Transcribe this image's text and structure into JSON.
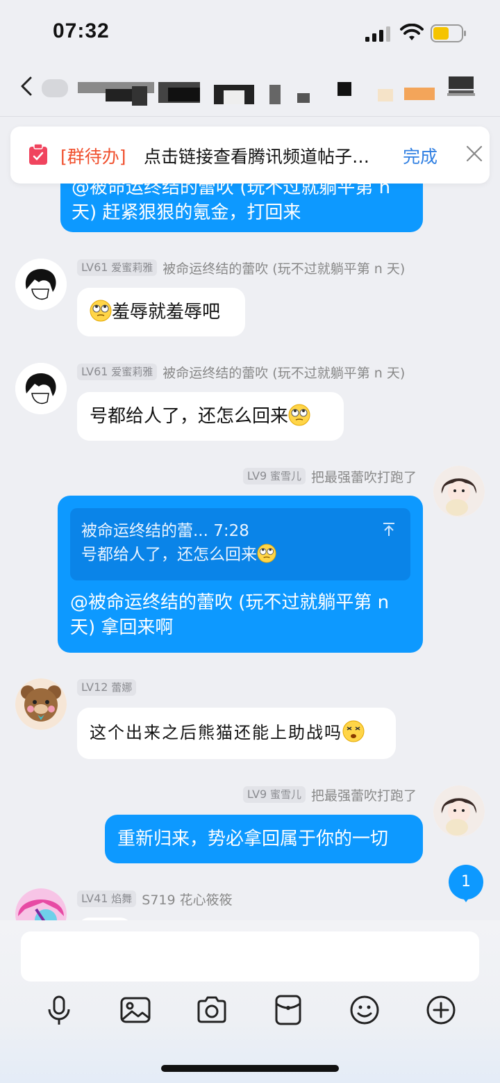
{
  "status_bar": {
    "time": "07:32",
    "battery_color": "#f5c400"
  },
  "header": {
    "back_icon": "chevron-left-icon",
    "title_redacted": true
  },
  "todo_banner": {
    "tag": "[群待办]",
    "text": "点击链接查看腾讯频道帖子…",
    "done_label": "完成",
    "icon": "clipboard-icon",
    "close_icon": "close-icon"
  },
  "messages": [
    {
      "id": "m0",
      "side": "right",
      "text_line1": "@被命运终结的蕾吹 (玩不过就躺平第 n",
      "text_line2": "天) 赶紧狠狠的氪金，打回来"
    },
    {
      "id": "m1",
      "side": "left",
      "level": "LV61",
      "title": "爱蜜莉雅",
      "name": "被命运终结的蕾吹 (玩不过就躺平第 n 天)",
      "text": "羞辱就羞辱吧",
      "emoji_first": true
    },
    {
      "id": "m2",
      "side": "left",
      "level": "LV61",
      "title": "爱蜜莉雅",
      "name": "被命运终结的蕾吹 (玩不过就躺平第 n 天)",
      "text": "号都给人了，还怎么回来",
      "emoji_last": true
    },
    {
      "id": "m3",
      "side": "right",
      "level": "LV9",
      "title": "蜜雪儿",
      "name": "把最强蕾吹打跑了",
      "quote_sender": "被命运终结的蕾...",
      "quote_time": "7:28",
      "quote_text": "号都给人了，还怎么回来",
      "text_line1": "@被命运终结的蕾吹 (玩不过就躺平第 n",
      "text_line2": "天) 拿回来啊"
    },
    {
      "id": "m4",
      "side": "left",
      "level": "LV12",
      "title": "蕾娜",
      "name": "",
      "text": "这个出来之后熊猫还能上助战吗"
    },
    {
      "id": "m5",
      "side": "right",
      "level": "LV9",
      "title": "蜜雪儿",
      "name": "把最强蕾吹打跑了",
      "text": "重新归来，势必拿回属于你的一切"
    },
    {
      "id": "m6",
      "side": "left",
      "level": "LV41",
      "title": "焰舞",
      "name": "S719 花心筱筱"
    }
  ],
  "unread_count": "1",
  "input": {
    "placeholder": ""
  },
  "toolbar": [
    "microphone-icon",
    "image-icon",
    "camera-icon",
    "red-packet-icon",
    "emoji-icon",
    "plus-icon"
  ],
  "colors": {
    "accent": "#0d99ff",
    "todo_tag": "#f0502e",
    "done": "#2f7fe2"
  }
}
